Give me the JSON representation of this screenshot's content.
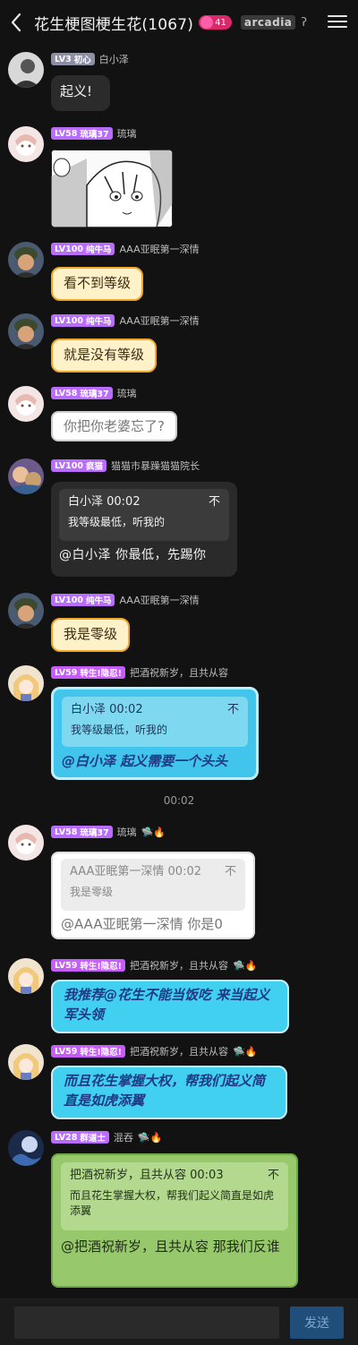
{
  "header": {
    "title": "花生梗图梗生花(1067)",
    "badge_count": "41",
    "brand_text": "arcadia",
    "ear_symbol": "ʔ"
  },
  "colors": {
    "level_purple": "#b96cff",
    "cream_bubble": "#fff2c8",
    "cyan_bubble": "#41d0ef",
    "green_bubble": "#97c86b"
  },
  "messages": [
    {
      "level": "LV3",
      "tag": "初心",
      "user": "白小泽",
      "text": "起义!"
    },
    {
      "level": "LV58",
      "tag": "琉璃37",
      "user": "琉璃",
      "image_alt": "manga sticker"
    },
    {
      "level": "LV100",
      "tag": "纯牛马",
      "user": "AAA亚眠第一深情",
      "text": "看不到等级"
    },
    {
      "level": "LV100",
      "tag": "纯牛马",
      "user": "AAA亚眠第一深情",
      "text": "就是没有等级"
    },
    {
      "level": "LV58",
      "tag": "琉璃37",
      "user": "琉璃",
      "text": "你把你老婆忘了?"
    },
    {
      "level": "LV100",
      "tag": "疯猫",
      "user": "猫猫市暴躁猫猫院长",
      "quote_head": "白小泽 00:02",
      "quote_body": "我等级最低，听我的",
      "text": "@白小泽  你最低，先踢你"
    },
    {
      "level": "LV100",
      "tag": "纯牛马",
      "user": "AAA亚眠第一深情",
      "text": "我是零级"
    },
    {
      "level": "LV59",
      "tag": "转生!隐忍!",
      "user": "把酒祝新岁，且共从容",
      "quote_head": "白小泽 00:02",
      "quote_body": "我等级最低，听我的",
      "text": "@白小泽  起义需要一个头头"
    },
    {
      "time": "00:02"
    },
    {
      "level": "LV58",
      "tag": "琉璃37",
      "user": "琉璃",
      "quote_head": "AAA亚眠第一深情 00:02",
      "quote_body": "我是零级",
      "text": "@AAA亚眠第一深情 你是0"
    },
    {
      "level": "LV59",
      "tag": "转生!隐忍!",
      "user": "把酒祝新岁，且共从容",
      "text": "我推荐@花生不能当饭吃  来当起义军头领"
    },
    {
      "level": "LV59",
      "tag": "转生!隐忍!",
      "user": "把酒祝新岁，且共从容",
      "text": "而且花生掌握大权，帮我们起义简直是如虎添翼"
    },
    {
      "level": "LV28",
      "tag": "群道士",
      "user": "混吞",
      "quote_head": "把酒祝新岁，且共从容 00:03",
      "quote_body": "而且花生掌握大权，帮我们起义简直是如虎添翼",
      "text": "@把酒祝新岁，且共从容  那我们反谁"
    }
  ],
  "composer": {
    "placeholder": "",
    "send_label": "发送"
  },
  "quote_close": "不"
}
